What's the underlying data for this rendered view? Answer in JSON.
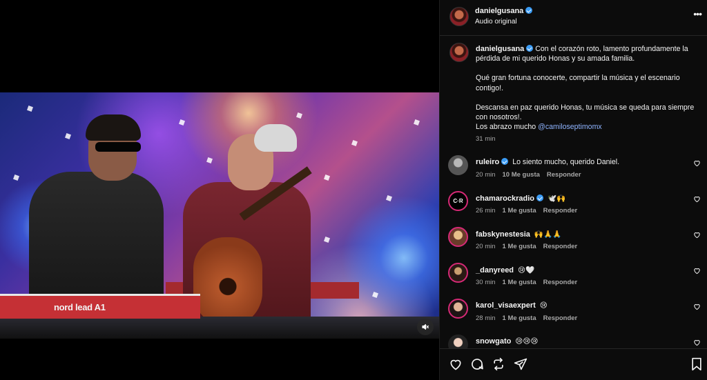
{
  "video": {
    "keyboard_label": "nord lead A1"
  },
  "header": {
    "username": "danielgusana",
    "subtitle": "Audio original",
    "more": "•••"
  },
  "caption": {
    "username": "danielgusana",
    "line1": "Con el corazón roto, lamento profundamente la pérdida de mi querido Honas y su amada familia.",
    "line2": "Qué gran fortuna conocerte, compartir la música y el escenario contigo!.",
    "line3": "Descansa en paz querido Honas, tu música se queda para siempre con nosotros!.",
    "line4_prefix": "Los abrazo mucho ",
    "mention": "@camiloseptimomx",
    "time": "31 min"
  },
  "comments": [
    {
      "username": "ruleiro",
      "text": "Lo siento mucho, querido Daniel.",
      "time": "20 min",
      "likes": "10 Me gusta",
      "reply": "Responder"
    },
    {
      "username": "chamarockradio",
      "text": "🕊️🙌",
      "time": "26 min",
      "likes": "1 Me gusta",
      "reply": "Responder",
      "avatar_text": "C·R"
    },
    {
      "username": "fabskynestesia",
      "text": "🙌🙏🙏",
      "time": "20 min",
      "likes": "1 Me gusta",
      "reply": "Responder"
    },
    {
      "username": "_danyreed",
      "text": "😢🤍",
      "time": "30 min",
      "likes": "1 Me gusta",
      "reply": "Responder"
    },
    {
      "username": "karol_visaexpert",
      "text": "😢",
      "time": "28 min",
      "likes": "1 Me gusta",
      "reply": "Responder"
    },
    {
      "username": "snowgato",
      "text": "😢😢😢"
    }
  ]
}
